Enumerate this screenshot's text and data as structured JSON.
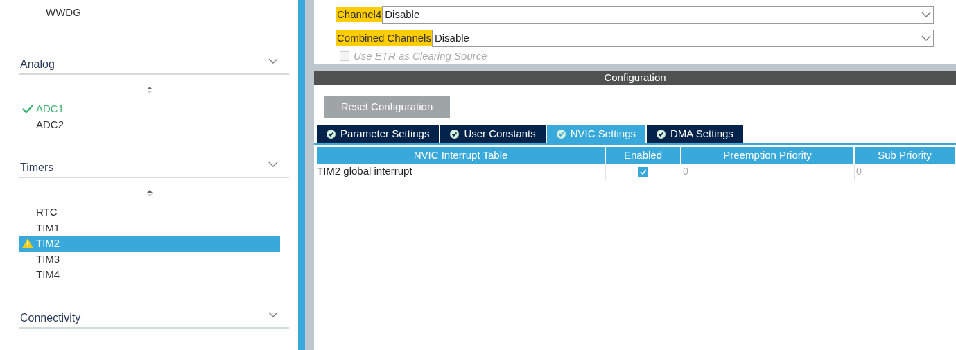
{
  "sidebar": {
    "top_items": [
      {
        "label": "WWDG",
        "selected": false
      }
    ],
    "groups": [
      {
        "title": "Analog",
        "items": [
          {
            "label": "ADC1",
            "kind": "ok",
            "selected": false
          },
          {
            "label": "ADC2",
            "kind": "plain",
            "selected": false
          }
        ]
      },
      {
        "title": "Timers",
        "items": [
          {
            "label": "RTC",
            "kind": "plain",
            "selected": false
          },
          {
            "label": "TIM1",
            "kind": "plain",
            "selected": false
          },
          {
            "label": "TIM2",
            "kind": "warning",
            "selected": true
          },
          {
            "label": "TIM3",
            "kind": "plain",
            "selected": false
          },
          {
            "label": "TIM4",
            "kind": "plain",
            "selected": false
          }
        ]
      },
      {
        "title": "Connectivity"
      }
    ]
  },
  "mode": {
    "fields": [
      {
        "label": "Channel4",
        "value": "Disable"
      },
      {
        "label": "Combined Channels",
        "value": "Disable"
      }
    ],
    "checkbox": {
      "label": "Use ETR as Clearing Source",
      "checked": false,
      "disabled": true
    }
  },
  "configuration": {
    "title": "Configuration",
    "reset_button": "Reset Configuration",
    "tabs": [
      {
        "label": "Parameter Settings",
        "selected": false
      },
      {
        "label": "User Constants",
        "selected": false
      },
      {
        "label": "NVIC Settings",
        "selected": true
      },
      {
        "label": "DMA Settings",
        "selected": false
      }
    ],
    "table": {
      "columns": [
        "NVIC Interrupt Table",
        "Enabled",
        "Preemption Priority",
        "Sub Priority"
      ],
      "rows": [
        {
          "name": "TIM2 global interrupt",
          "enabled": true,
          "preemption": "0",
          "sub": "0"
        }
      ]
    }
  }
}
